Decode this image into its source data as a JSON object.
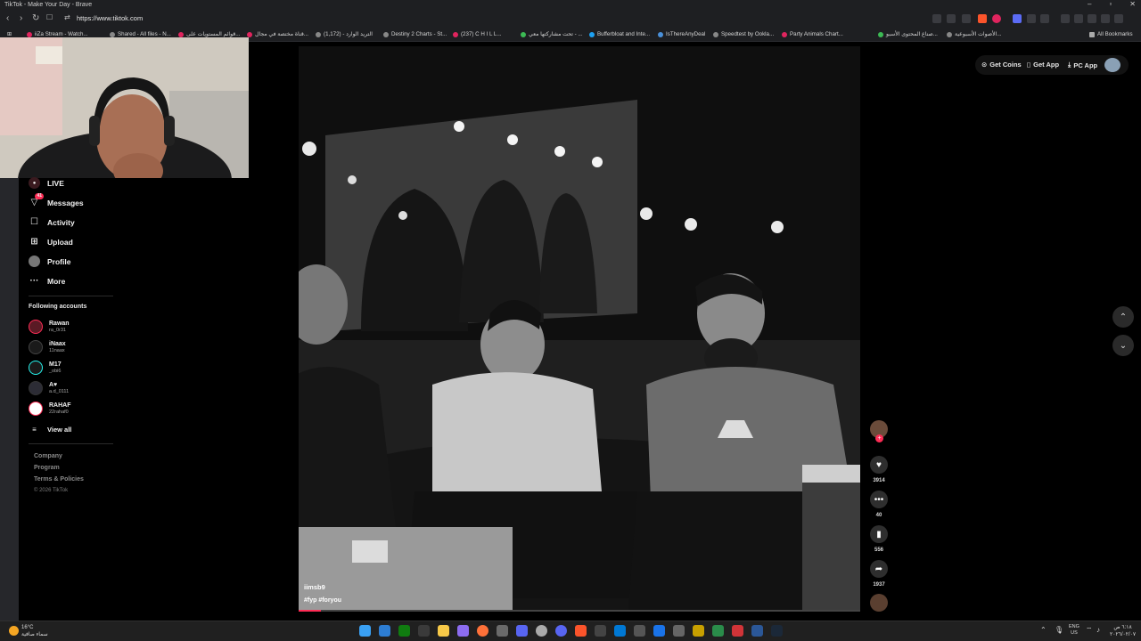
{
  "window": {
    "title": "TikTok - Make Your Day - Brave"
  },
  "browser": {
    "url": "https://www.tiktok.com"
  },
  "bookmarks": [
    "iiZa Stream - Watch...",
    "Shared - All files - N...",
    "قوائم المستويات على...",
    "قناة مختصة في مجال...",
    "التريد الوارد - (1,172)",
    "Destiny 2 Charts - St...",
    "(237) C H I L L...",
    "تحت مشاركتها معي - ...",
    "Bufferbloat and Inte...",
    "IsThereAnyDeal",
    "Speedtest by Ookla...",
    "Party Animals Chart...",
    "صناع المحتوى الأسبو...",
    "الأصوات الأسبوعية...",
    "All Bookmarks"
  ],
  "sidebar": {
    "nav": [
      "LIVE",
      "Messages",
      "Activity",
      "Upload",
      "Profile",
      "More"
    ],
    "messages_badge": "41",
    "following_title": "Following accounts",
    "accounts": [
      {
        "name": "Rawan",
        "user": "ra_0r31"
      },
      {
        "name": "iNaax",
        "user": "11naax"
      },
      {
        "name": "M17",
        "user": "_obi6"
      },
      {
        "name": "A♥",
        "user": "a.d_0111"
      },
      {
        "name": "RAHAF",
        "user": "22rahaf0"
      }
    ],
    "view_all": "View all",
    "footer": [
      "Company",
      "Program",
      "Terms & Policies"
    ],
    "copyright": "© 2026 TikTok"
  },
  "topbar": {
    "get_coins": "Get Coins",
    "get_app": "Get App",
    "pc_app": "PC App"
  },
  "video": {
    "author": "iimsb9",
    "caption": "#fyp #foryou",
    "progress": 0.04
  },
  "actions": {
    "likes": "3914",
    "comments": "40",
    "saves": "556",
    "shares": "1937"
  },
  "taskbar": {
    "weather_temp": "16°C",
    "weather_desc": "سماء صافية",
    "lang_top": "ENG",
    "lang_bottom": "US",
    "time": "٦:١٨ ص",
    "date": "٢٠٢٦/٠٢/٠٧"
  },
  "colors": {
    "accent": "#fe2c55",
    "teal": "#25f4ee",
    "chrome": "#1e1f22"
  }
}
